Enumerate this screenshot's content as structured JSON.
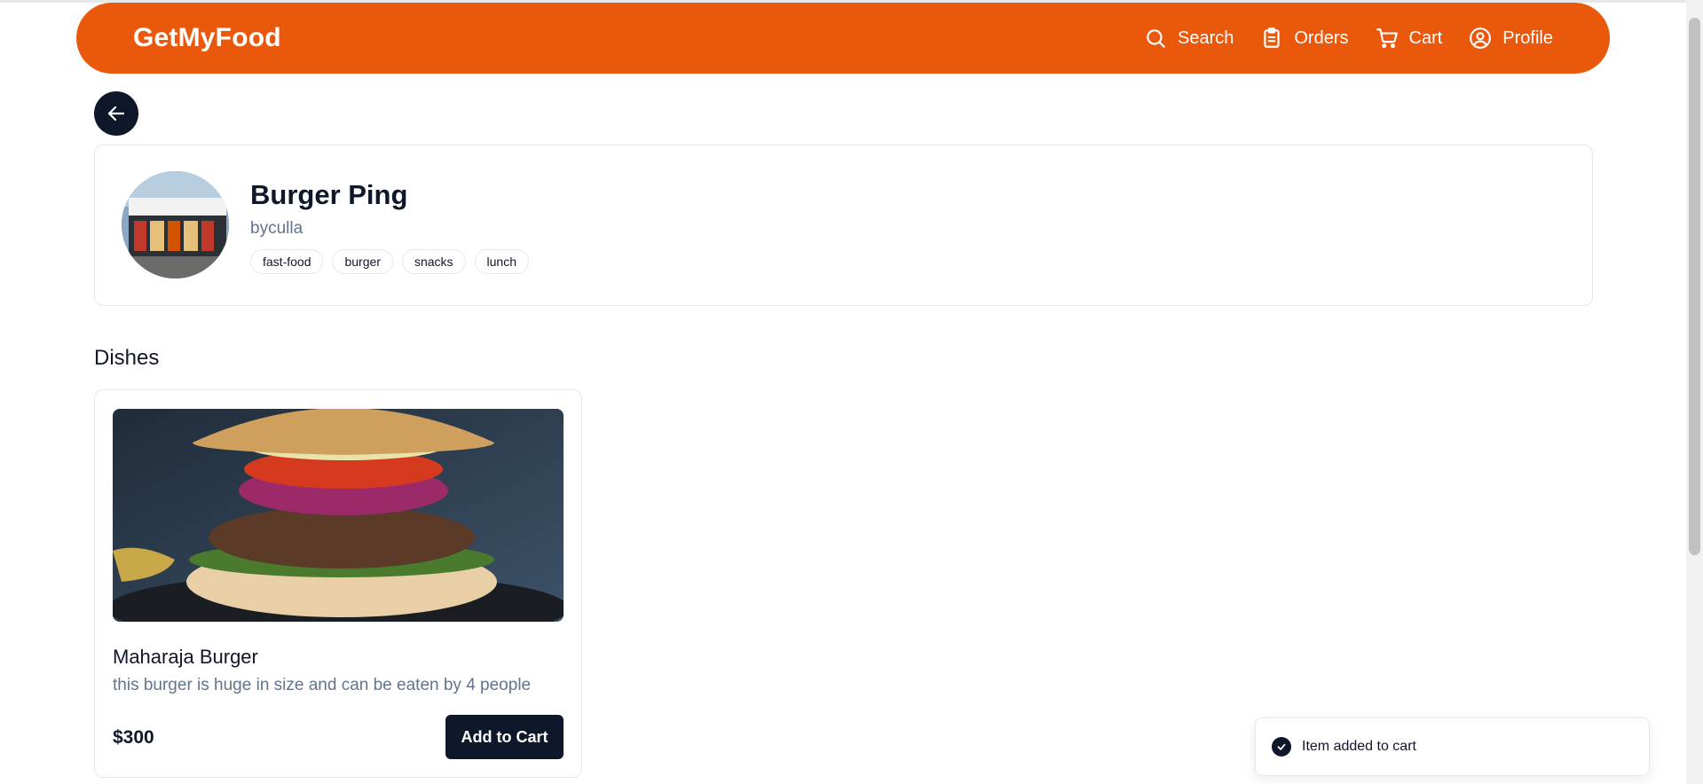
{
  "navbar": {
    "brand": "GetMyFood",
    "links": [
      {
        "label": "Search",
        "icon": "search-icon"
      },
      {
        "label": "Orders",
        "icon": "clipboard-icon"
      },
      {
        "label": "Cart",
        "icon": "cart-icon"
      },
      {
        "label": "Profile",
        "icon": "user-circle-icon"
      }
    ]
  },
  "back_button": {
    "icon": "arrow-left-icon"
  },
  "restaurant": {
    "name": "Burger Ping",
    "location": "byculla",
    "tags": [
      "fast-food",
      "burger",
      "snacks",
      "lunch"
    ]
  },
  "dishes_section": {
    "title": "Dishes",
    "items": [
      {
        "name": "Maharaja Burger",
        "description": "this burger is huge in size and can be eaten by 4 people",
        "price": "$300",
        "button_label": "Add to Cart"
      }
    ]
  },
  "toast": {
    "message": "Item added to cart",
    "icon": "check-circle-icon"
  },
  "colors": {
    "brand": "#ea580c",
    "dark": "#0f172a",
    "muted": "#64748b",
    "border": "#e5e7eb"
  }
}
